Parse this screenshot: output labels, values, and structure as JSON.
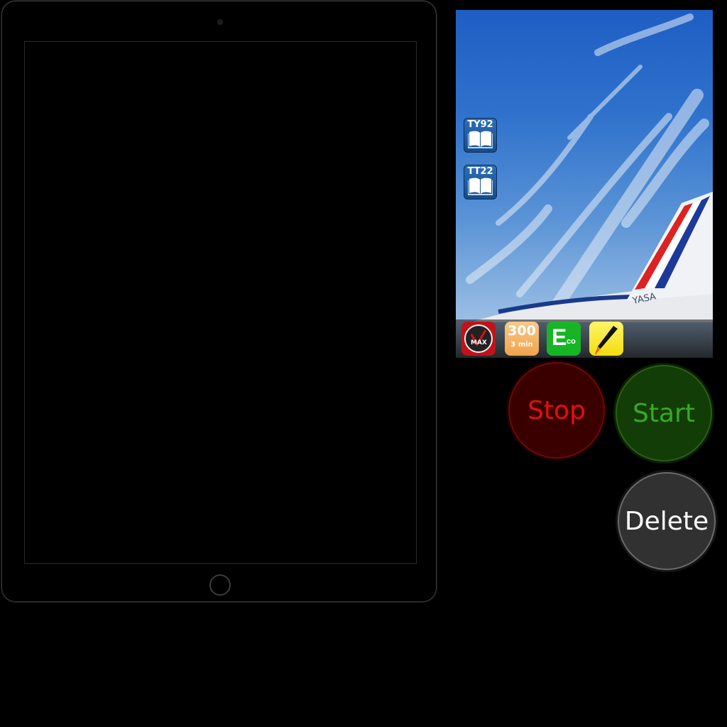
{
  "preview": {
    "books": [
      {
        "label": "TY92"
      },
      {
        "label": "TT22"
      }
    ],
    "dock": {
      "vmax_label": "MAX",
      "timer_value": "300",
      "timer_unit": "3 min",
      "eco_big": "E",
      "eco_small": "co"
    },
    "plane_text": "YASA"
  },
  "buttons": {
    "stop": "Stop",
    "start": "Start",
    "delete": "Delete"
  },
  "colors": {
    "stop_text": "#e01010",
    "start_text": "#3aa824",
    "delete_bg": "#313131"
  }
}
